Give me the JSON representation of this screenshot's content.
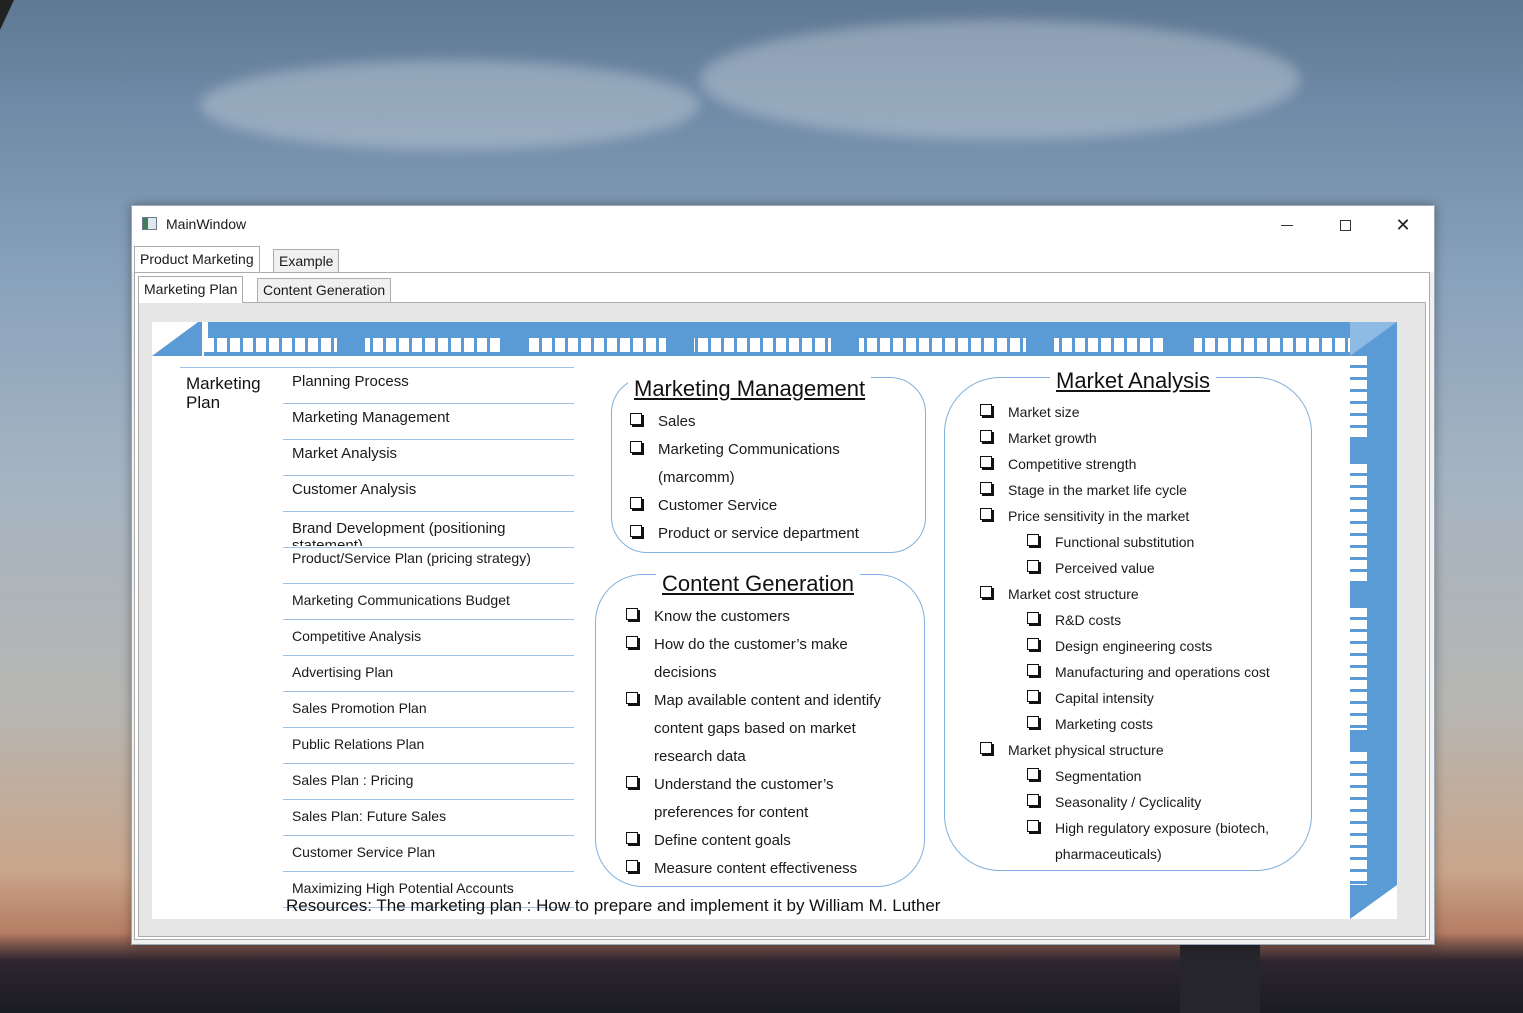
{
  "window": {
    "title": "MainWindow",
    "controls": {
      "minimize": "—",
      "maximize": "☐",
      "close": "✕"
    }
  },
  "outer_tabs": [
    {
      "label": "Product Marketing",
      "selected": true
    },
    {
      "label": "Example",
      "selected": false
    }
  ],
  "inner_tabs": [
    {
      "label": "Marketing Plan",
      "selected": true
    },
    {
      "label": "Content Generation",
      "selected": false
    }
  ],
  "slide": {
    "accent_color": "#5b9bd5",
    "marketing_plan_label": "Marketing Plan",
    "toc": [
      "Planning Process",
      "Marketing Management",
      "Market Analysis",
      "Customer Analysis",
      "Brand Development (positioning statement)",
      "Product/Service Plan (pricing strategy)",
      "Marketing Communications Budget",
      "Competitive Analysis",
      "Advertising Plan",
      "Sales Promotion Plan",
      "Public Relations Plan",
      "Sales Plan : Pricing",
      "Sales Plan: Future Sales",
      "Customer Service Plan",
      "Maximizing High Potential Accounts"
    ],
    "marketing_management": {
      "title": "Marketing Management",
      "items": [
        "Sales",
        "Marketing Communications",
        "(marcomm)",
        "Customer Service",
        "Product or service department"
      ]
    },
    "content_generation": {
      "title": "Content Generation",
      "items": [
        "Know the customers",
        "How do the customer’s make",
        "decisions",
        "Map available content and identify",
        "content gaps based on market",
        "research data",
        "Understand the customer’s",
        "preferences for content",
        "Define content goals",
        "Measure content effectiveness"
      ]
    },
    "market_analysis": {
      "title": "Market Analysis",
      "items": [
        "Market size",
        "Market growth",
        "Competitive strength",
        "Stage in the market life cycle",
        "Price sensitivity in the market",
        "Functional substitution",
        "Perceived value",
        "Market cost structure",
        "R&D costs",
        "Design engineering  costs",
        "Manufacturing and operations cost",
        "Capital intensity",
        "Marketing costs",
        "Market physical structure",
        "Segmentation",
        "Seasonality / Cyclicality",
        "High regulatory exposure (biotech,",
        "pharmaceuticals)"
      ]
    },
    "resources": "Resources: The marketing plan : How to prepare and implement it by William M. Luther"
  }
}
